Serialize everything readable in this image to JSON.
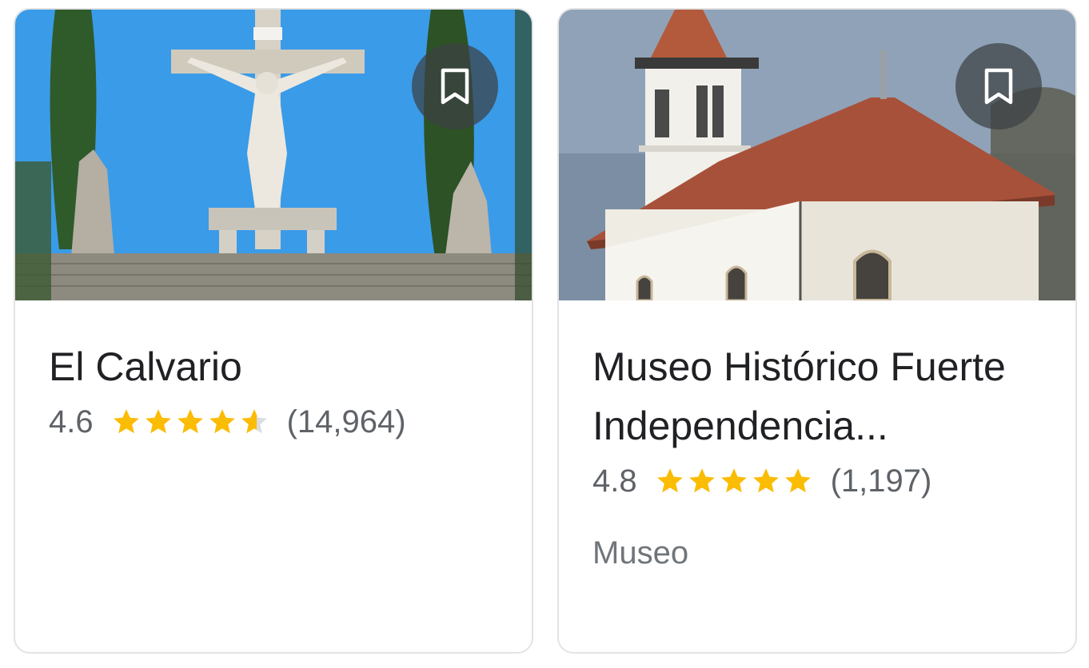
{
  "colors": {
    "star": "#fbbc04",
    "star_empty": "#dadce0",
    "text_primary": "#202124",
    "text_secondary": "#5f6368"
  },
  "cards": [
    {
      "title": "El Calvario",
      "rating": "4.6",
      "rating_value": 4.6,
      "reviews": "(14,964)",
      "save_icon": "bookmark-icon"
    },
    {
      "title": "Museo Histórico Fuerte Independencia...",
      "rating": "4.8",
      "rating_value": 4.8,
      "reviews": "(1,197)",
      "category": "Museo",
      "save_icon": "bookmark-icon"
    }
  ]
}
